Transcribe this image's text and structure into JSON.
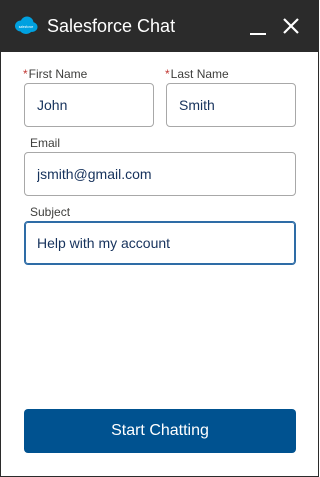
{
  "window": {
    "title": "Salesforce Chat",
    "logo_text": "salesforce"
  },
  "form": {
    "first_name": {
      "label": "First Name",
      "required_mark": "*",
      "value": "John"
    },
    "last_name": {
      "label": "Last Name",
      "required_mark": "*",
      "value": "Smith"
    },
    "email": {
      "label": "Email",
      "value": "jsmith@gmail.com"
    },
    "subject": {
      "label": "Subject",
      "value": "Help with my account"
    }
  },
  "actions": {
    "start_label": "Start Chatting"
  },
  "colors": {
    "header_bg": "#2b2b2b",
    "brand_cloud": "#00a1e0",
    "button_bg": "#005290",
    "required": "#c23934"
  }
}
